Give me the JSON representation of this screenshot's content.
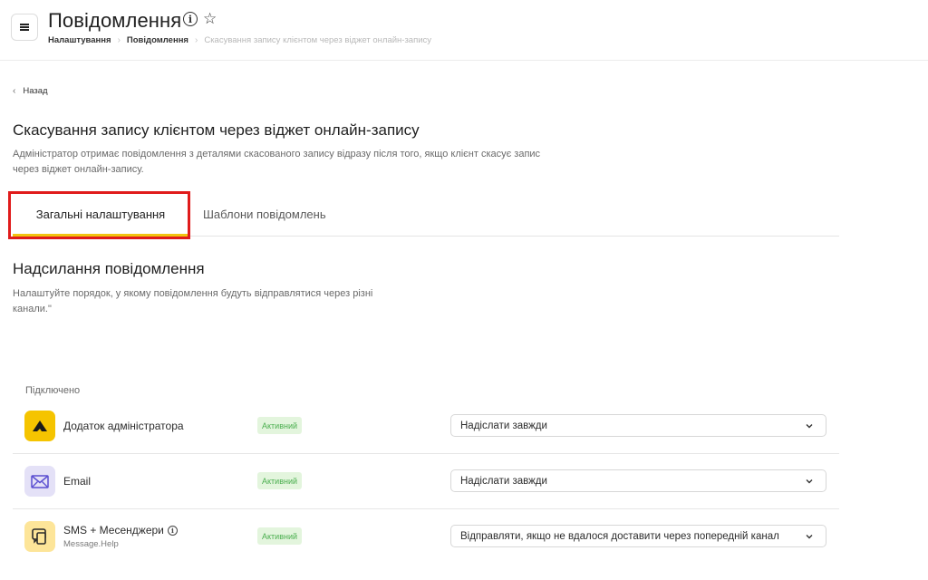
{
  "header": {
    "title": "Повідомлення",
    "breadcrumb": [
      "Налаштування",
      "Повідомлення",
      "Скасування запису клієнтом через віджет онлайн-запису"
    ]
  },
  "back_label": "Назад",
  "section": {
    "title": "Скасування запису клієнтом через віджет онлайн-запису",
    "description": "Адміністратор отримає повідомлення з деталями скасованого запису відразу після того, якщо клієнт скасує запис через віджет онлайн-запису."
  },
  "tabs": [
    {
      "label": "Загальні налаштування",
      "active": true
    },
    {
      "label": "Шаблони повідомлень",
      "active": false
    }
  ],
  "sending": {
    "title": "Надсилання повідомлення",
    "description": "Налаштуйте порядок, у якому повідомлення будуть відправлятися через різні канали.\""
  },
  "connected_label": "Підключено",
  "channels": [
    {
      "name": "Додаток адміністратора",
      "sub": "",
      "icon": "admin-app-logo-icon",
      "status": "Активний",
      "option": "Надіслати завжди"
    },
    {
      "name": "Email",
      "sub": "",
      "icon": "envelope-icon",
      "status": "Активний",
      "option": "Надіслати завжди"
    },
    {
      "name": "SMS + Месенджери",
      "sub": "Message.Help",
      "icon": "chat-phone-icon",
      "status": "Активний",
      "option": "Відправляти, якщо не вдалося доставити через попередній канал"
    }
  ],
  "colors": {
    "accent": "#f1c40f",
    "highlight": "#e01b1b",
    "badge_bg": "#e3f5dd",
    "badge_text": "#4caf50"
  }
}
